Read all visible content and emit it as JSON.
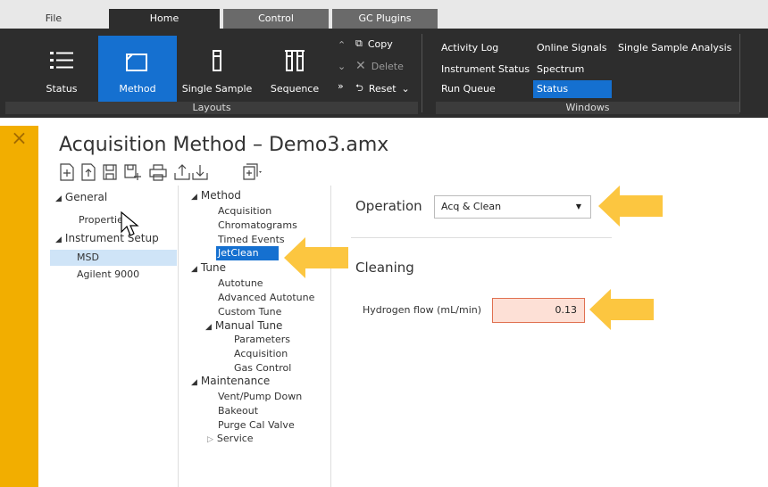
{
  "tabs": {
    "file": "File",
    "home": "Home",
    "control": "Control",
    "gc_plugins": "GC Plugins"
  },
  "ribbon": {
    "status": "Status",
    "method": "Method",
    "single_sample": "Single Sample",
    "sequence": "Sequence",
    "copy": "Copy",
    "delete": "Delete",
    "reset": "Reset",
    "layouts_group": "Layouts",
    "windows_group": "Windows",
    "windows": {
      "activity_log": "Activity Log",
      "instrument_status": "Instrument Status",
      "run_queue": "Run Queue",
      "online_signals": "Online Signals",
      "spectrum": "Spectrum",
      "status": "Status",
      "single_sample_analysis": "Single Sample Analysis"
    }
  },
  "page": {
    "title": "Acquisition Method – Demo3.amx"
  },
  "left_tree": {
    "general": "General",
    "properties": "Properties",
    "instrument_setup": "Instrument Setup",
    "msd": "MSD",
    "agilent": "Agilent 9000"
  },
  "method_tree": {
    "method": "Method",
    "acquisition": "Acquisition",
    "chromatograms": "Chromatograms",
    "timed_events": "Timed Events",
    "jetclean": "JetClean",
    "tune": "Tune",
    "autotune": "Autotune",
    "advanced_autotune": "Advanced Autotune",
    "custom_tune": "Custom Tune",
    "manual_tune": "Manual Tune",
    "parameters": "Parameters",
    "mt_acquisition": "Acquisition",
    "gas_control": "Gas Control",
    "maintenance": "Maintenance",
    "vent_pump_down": "Vent/Pump Down",
    "bakeout": "Bakeout",
    "purge_cal_valve": "Purge Cal Valve",
    "service": "Service"
  },
  "detail": {
    "operation_label": "Operation",
    "operation_value": "Acq & Clean",
    "cleaning_heading": "Cleaning",
    "hydrogen_label": "Hydrogen flow (mL/min)",
    "hydrogen_value": "0.13"
  },
  "colors": {
    "accent": "#1570d0",
    "ribbon": "#2d2d2d",
    "strip": "#f2ae00",
    "arrow": "#fcc640",
    "highlight_field": "#fde0d6"
  }
}
